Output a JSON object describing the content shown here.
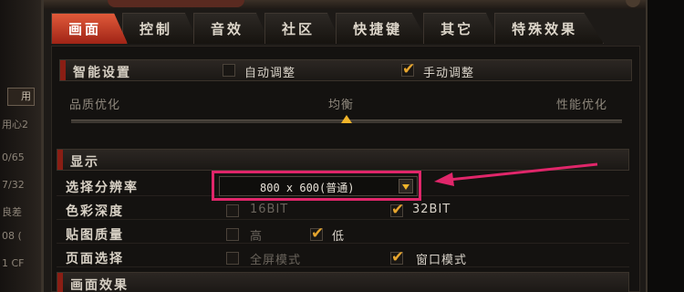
{
  "left_fragments": [
    "用心2",
    "0/65",
    "7/32",
    "良差",
    "08 (",
    "1 CF"
  ],
  "left_button": "用",
  "tabs": [
    {
      "label": "画面",
      "active": true
    },
    {
      "label": "控制",
      "active": false
    },
    {
      "label": "音效",
      "active": false
    },
    {
      "label": "社区",
      "active": false
    },
    {
      "label": "快捷键",
      "active": false
    },
    {
      "label": "其它",
      "active": false
    },
    {
      "label": "特殊效果",
      "active": false
    }
  ],
  "smart": {
    "title": "智能设置",
    "auto_label": "自动调整",
    "auto_checked": false,
    "manual_label": "手动调整",
    "manual_checked": true
  },
  "slider": {
    "left_label": "品质优化",
    "mid_label": "均衡",
    "right_label": "性能优化",
    "position": 0.5
  },
  "display": {
    "title": "显示",
    "resolution_label": "选择分辨率",
    "resolution_value": "800 x 600(普通)",
    "color_depth_label": "色彩深度",
    "color_16": "16BIT",
    "color_16_checked": false,
    "color_32": "32BIT",
    "color_32_checked": true,
    "texture_label": "贴图质量",
    "texture_high": "高",
    "texture_high_checked": false,
    "texture_low": "低",
    "texture_low_checked": true,
    "mode_label": "页面选择",
    "mode_full": "全屏模式",
    "mode_full_checked": false,
    "mode_window": "窗口模式",
    "mode_window_checked": true
  },
  "effects": {
    "title": "画面效果"
  },
  "colors": {
    "accent": "#e0266a",
    "check": "#e6a52e",
    "tab_active": "#c43a22"
  }
}
